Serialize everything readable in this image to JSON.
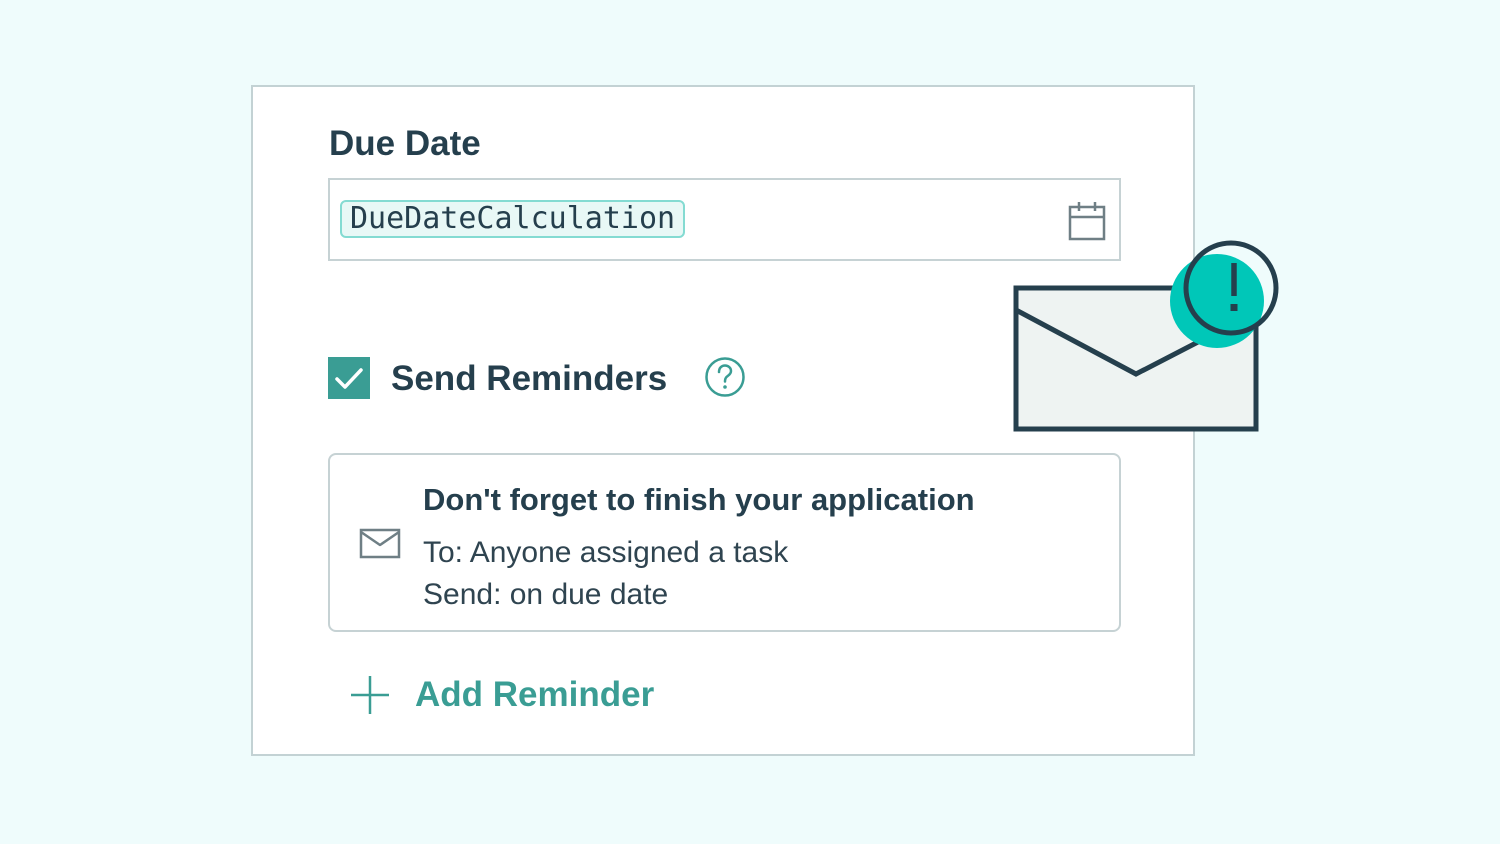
{
  "due_date": {
    "label": "Due Date",
    "value": "DueDateCalculation",
    "icon": "calendar-icon"
  },
  "send_reminders": {
    "label": "Send Reminders",
    "checked": true,
    "help_icon": "question-circle-icon"
  },
  "reminder": {
    "title": "Don't forget to finish your application",
    "to": "To: Anyone assigned a task",
    "send": "Send: on due date",
    "icon": "mail-icon"
  },
  "add_reminder": {
    "label": "Add Reminder",
    "icon": "plus-icon"
  },
  "illustration": {
    "icon": "envelope-alert-icon"
  },
  "colors": {
    "background": "#effcfc",
    "accent": "#3a9d94",
    "alert": "#00c7b8",
    "text": "#253f4d",
    "border": "#c6d2d4"
  }
}
